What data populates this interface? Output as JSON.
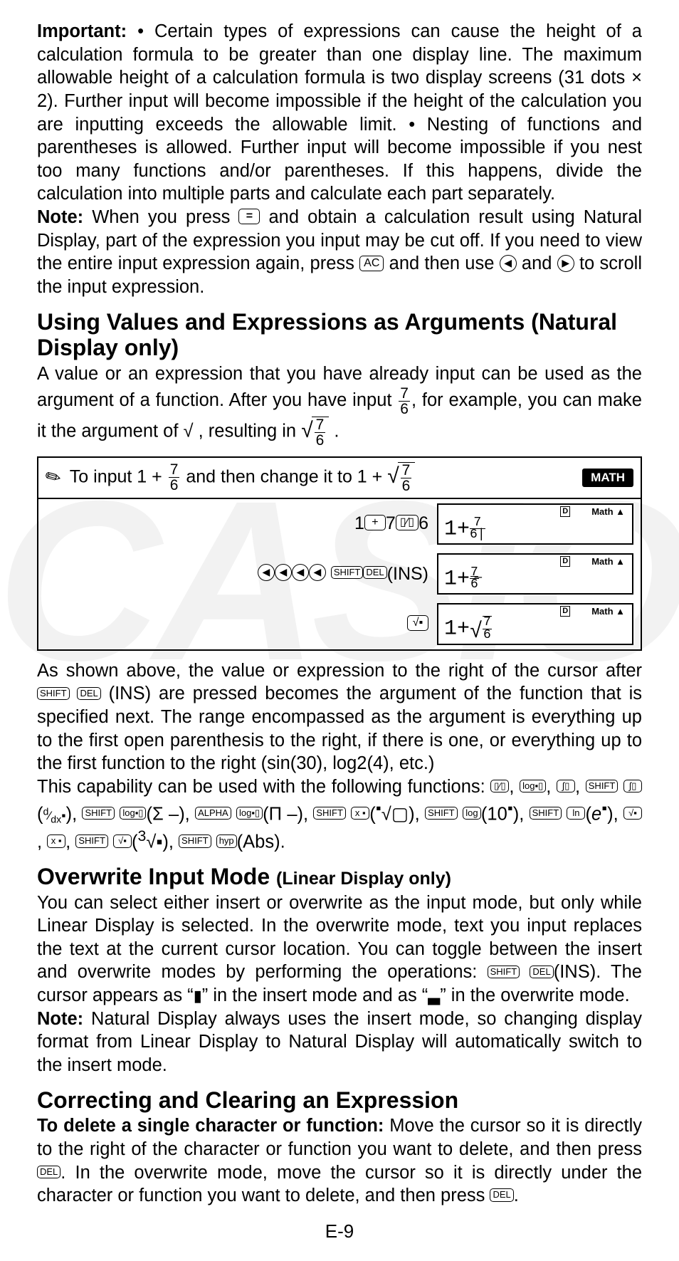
{
  "important_label": "Important:",
  "important_p1": "• Certain types of expressions can cause the height of a calculation formula to be greater than one display line. The maximum allowable height of a calculation formula is two display screens (31 dots × 2). Further input will become impossible if the height of the calculation you are inputting exceeds the allowable limit. • Nesting of functions and parentheses is allowed. Further input will become impossible if you nest too many functions and/or parentheses. If this happens, divide the calculation into multiple parts and calculate each part separately.",
  "note_label": "Note:",
  "note_p1a": "When you press ",
  "note_p1b": " and obtain a calculation result using Natural Display, part of the expression you input may be cut off. If you need to view the entire input expression again, press ",
  "note_p1c": " and then use ",
  "note_p1d": " and ",
  "note_p1e": " to scroll the input expression.",
  "h_args": "Using Values and Expressions as Arguments (Natural Display only)",
  "args_p_a": "A value or an expression that you have already input can be used as the argument of a function. After you have input ",
  "args_frac1_n": "7",
  "args_frac1_d": "6",
  "args_p_b": ", for example, you can make it the argument of √  , resulting in ",
  "args_frac2_n": "7",
  "args_frac2_d": "6",
  "args_p_c": " .",
  "ex_intro_a": "To input 1 + ",
  "ex_intro_b": " and then change it to 1 + ",
  "ex_math_badge": "MATH",
  "ex_r1_keys_a": "1 ",
  "ex_r1_keys_plus": "+",
  "ex_r1_keys_b": " 7 ",
  "ex_r1_keys_frac": "▯⁄▯",
  "ex_r1_keys_c": " 6",
  "ex_r2_ins": "(INS)",
  "screen_D": "D",
  "screen_Math": "Math ▲",
  "screen1": "1+",
  "screen1_fn": "7",
  "screen1_fd": "6|",
  "screen2": "1+",
  "screen2_fn": "7̲",
  "screen2_fd": "6",
  "screen3": "1+",
  "screen3_fn": "7",
  "screen3_fd": "6",
  "below_ex_a": "As shown above, the value or expression to the right of the cursor after ",
  "below_ex_b": "(INS) are pressed becomes the argument of the function that is specified next. The range encompassed as the argument is everything up to the first open parenthesis to the right, if there is one, or everything up to the first function to the right (sin(30), log2(4), etc.)",
  "cap_a": "This capability can be used with the following functions: ",
  "cap_list": ", , , ( d/dx ▪ ), (Σ – ), (Π – ), ( ▪√▢ ), (10 ▪ ), ( e ▪ ), , , ( ³√▪ ), (Abs).",
  "h_over": "Overwrite Input Mode",
  "h_over_sub": "(Linear Display only)",
  "over_p_a": "You can select either insert or overwrite as the input mode, but only while Linear Display is selected. In the overwrite mode, text you input replaces the text at the current cursor location. You can toggle between the insert and overwrite modes by performing the operations: ",
  "over_p_b": "(INS). The cursor appears as “",
  "over_cursor_ins": "▮",
  "over_p_c": "” in the insert mode and as “",
  "over_cursor_ovr": "▃",
  "over_p_d": "” in the overwrite mode.",
  "over_note": "Natural Display always uses the insert mode, so changing display format from Linear Display to Natural Display will automatically switch to the insert mode.",
  "h_corr": "Correcting and Clearing an Expression",
  "corr_l1": "To delete a single character or function:",
  "corr_p_a": " Move the cursor so it is directly to the right of the character or function you want to delete, and then press ",
  "corr_p_b": ". In the overwrite mode, move the cursor so it is directly under the character or function you want to delete, and then press ",
  "corr_p_c": ".",
  "k_eq": "=",
  "k_ac": "AC",
  "k_left": "◀",
  "k_right": "▶",
  "k_shift": "SHIFT",
  "k_del": "DEL",
  "k_plus": "+",
  "k_hyp": "hyp",
  "k_frackey": "▯⁄▯",
  "k_sqrt": "√▪",
  "k_log": "log",
  "k_logab": "log▪▯",
  "k_ln": "ln",
  "k_x2": "x ▪",
  "k_integ": "∫▯",
  "k_alpha": "ALPHA",
  "page_foot": "E-9"
}
